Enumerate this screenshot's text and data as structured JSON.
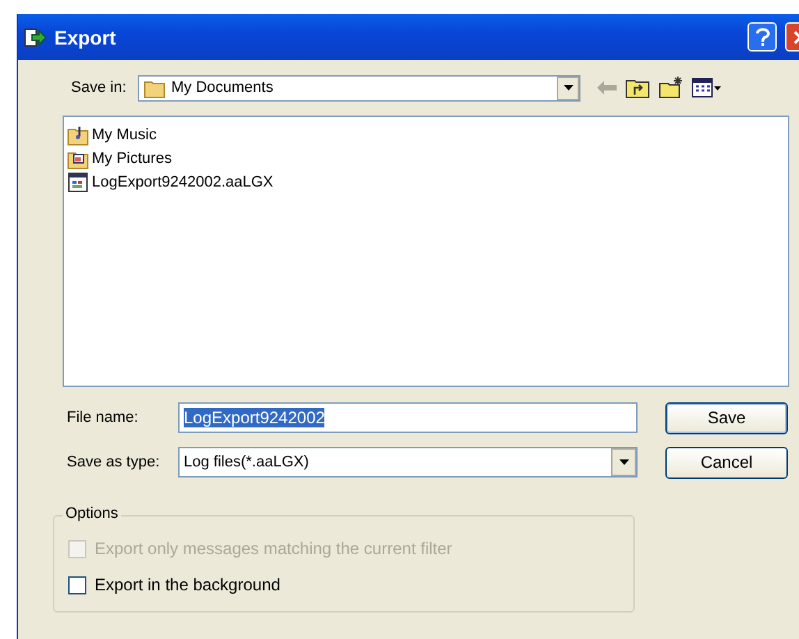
{
  "window": {
    "title": "Export"
  },
  "save_in": {
    "label": "Save in:",
    "value": "My Documents"
  },
  "files": [
    {
      "name": "My Music",
      "kind": "music"
    },
    {
      "name": "My Pictures",
      "kind": "pictures"
    },
    {
      "name": "LogExport9242002.aaLGX",
      "kind": "file"
    }
  ],
  "file_name": {
    "label": "File name:",
    "value": "LogExport9242002"
  },
  "save_as_type": {
    "label": "Save as type:",
    "value": "Log files(*.aaLGX)"
  },
  "buttons": [
    "Save",
    "Cancel"
  ],
  "options": {
    "title": "Options",
    "items": [
      {
        "label": "Export only messages matching the current filter",
        "checked": false,
        "disabled": true
      },
      {
        "label": "Export in the background",
        "checked": false,
        "disabled": false
      }
    ]
  }
}
